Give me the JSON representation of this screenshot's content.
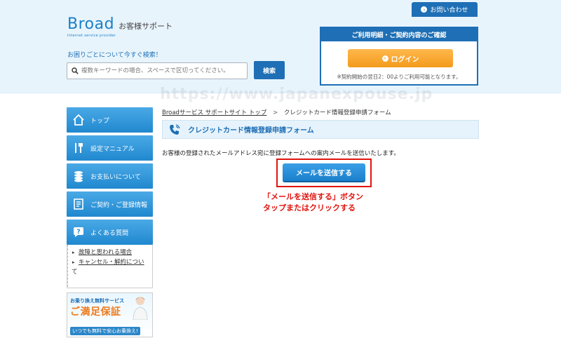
{
  "header": {
    "logo_word": "Broad",
    "logo_sub": "お客様サポート",
    "logo_tag": "Internet service provider",
    "contact_label": "お問い合わせ",
    "search_lead": "お困りごとについて今すぐ検索！",
    "search_placeholder": "複数キーワードの場合、スペースで区切ってください。",
    "search_button": "検索",
    "account_heading": "ご利用明細・ご契約内容のご確認",
    "login_label": "ログイン",
    "account_note": "※契約開始の翌日2：00よりご利用可能となります。",
    "watermark": "https://www.japanexpouse.jp"
  },
  "sidebar": {
    "items": [
      {
        "label": "トップ",
        "icon": "home-icon"
      },
      {
        "label": "設定マニュアル",
        "icon": "tools-icon"
      },
      {
        "label": "お支払いについて",
        "icon": "coins-icon"
      },
      {
        "label": "ご契約・ご登録情報",
        "icon": "document-icon"
      },
      {
        "label": "よくある質問",
        "icon": "question-icon"
      }
    ],
    "sub_links": [
      "故障と思われる場合",
      "キャンセル・解約につい",
      "て"
    ],
    "banner": {
      "top": "お乗り換え無料サービス",
      "main": "ご満足保証",
      "bottom": "いつでも無料で安心お乗換え!"
    }
  },
  "main": {
    "breadcrumb": {
      "home": "Broadサービス サポートサイト トップ",
      "separator": ">",
      "current": "クレジットカード情報登録申請フォーム"
    },
    "title": "クレジットカード情報登録申請フォーム",
    "description": "お客様の登録されたメールアドレス宛に登録フォームへの案内メールを送信いたします。",
    "send_button": "メールを送信する",
    "annotation_line1": "「メールを送信する」ボタン",
    "annotation_line2": "タップまたはクリックする"
  },
  "colors": {
    "brand_blue": "#1e6fb5",
    "login_orange": "#f39a1c",
    "annotation_red": "#e0140e",
    "header_bg": "#e8f4fc"
  }
}
